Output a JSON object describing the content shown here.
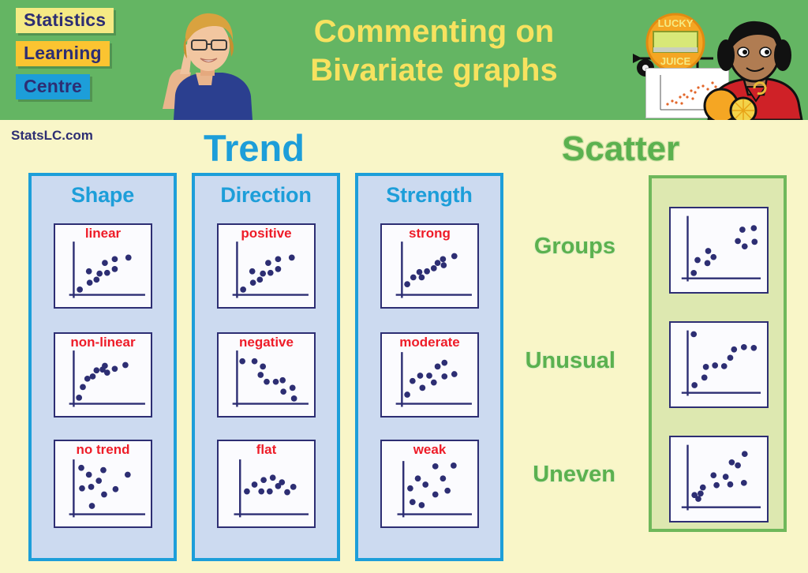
{
  "header": {
    "brand_lines": [
      "Statistics",
      "Learning",
      "Centre"
    ],
    "title_line1": "Commenting on",
    "title_line2": "Bivariate graphs",
    "cart_text_top": "LUCKY",
    "cart_text_bottom": "JUICE"
  },
  "site": {
    "url": "StatsLC.com"
  },
  "sections": {
    "trend": {
      "title": "Trend"
    },
    "scatter": {
      "title": "Scatter"
    }
  },
  "trend_panels": [
    {
      "heading": "Shape",
      "graphs": [
        "linear",
        "non-linear",
        "no trend"
      ]
    },
    {
      "heading": "Direction",
      "graphs": [
        "positive",
        "negative",
        "flat"
      ]
    },
    {
      "heading": "Strength",
      "graphs": [
        "strong",
        "moderate",
        "weak"
      ]
    }
  ],
  "scatter_rows": [
    {
      "label": "Groups"
    },
    {
      "label": "Unusual"
    },
    {
      "label": "Uneven"
    }
  ],
  "colors": {
    "header_green": "#64b563",
    "page_cream": "#f9f6c8",
    "panel_blue_fill": "#ccdaf0",
    "panel_blue_border": "#1d9ed9",
    "panel_green_fill": "#dde8b0",
    "panel_green_border": "#6fb85b",
    "label_red": "#ee1c28",
    "navy": "#2d2e73",
    "title_yellow": "#f7e25f",
    "scatter_green": "#5bb14f"
  },
  "chart_data": [
    {
      "type": "scatter",
      "title": "linear",
      "group": "Shape",
      "xlim": [
        0,
        100
      ],
      "ylim": [
        0,
        100
      ],
      "grid": false,
      "points": [
        [
          10,
          9
        ],
        [
          22,
          22
        ],
        [
          30,
          26
        ],
        [
          33,
          52
        ],
        [
          46,
          48
        ],
        [
          55,
          53
        ],
        [
          61,
          70
        ],
        [
          70,
          60
        ],
        [
          73,
          79
        ],
        [
          90,
          80
        ]
      ]
    },
    {
      "type": "scatter",
      "title": "non-linear",
      "group": "Shape",
      "xlim": [
        0,
        100
      ],
      "ylim": [
        0,
        100
      ],
      "grid": false,
      "points": [
        [
          9,
          10
        ],
        [
          16,
          30
        ],
        [
          23,
          46
        ],
        [
          31,
          51
        ],
        [
          38,
          62
        ],
        [
          46,
          64
        ],
        [
          53,
          70
        ],
        [
          58,
          58
        ],
        [
          67,
          64
        ],
        [
          85,
          72
        ]
      ]
    },
    {
      "type": "scatter",
      "title": "no trend",
      "group": "Shape",
      "xlim": [
        0,
        100
      ],
      "ylim": [
        0,
        100
      ],
      "grid": false,
      "points": [
        [
          12,
          77
        ],
        [
          24,
          64
        ],
        [
          14,
          40
        ],
        [
          29,
          40
        ],
        [
          36,
          50
        ],
        [
          44,
          78
        ],
        [
          48,
          28
        ],
        [
          62,
          36
        ],
        [
          80,
          60
        ],
        [
          33,
          8
        ]
      ]
    },
    {
      "type": "scatter",
      "title": "positive",
      "group": "Direction",
      "xlim": [
        0,
        100
      ],
      "ylim": [
        0,
        100
      ],
      "grid": false,
      "points": [
        [
          10,
          9
        ],
        [
          22,
          22
        ],
        [
          30,
          26
        ],
        [
          33,
          52
        ],
        [
          46,
          48
        ],
        [
          55,
          53
        ],
        [
          61,
          70
        ],
        [
          70,
          60
        ],
        [
          73,
          79
        ],
        [
          90,
          80
        ]
      ]
    },
    {
      "type": "scatter",
      "title": "negative",
      "group": "Direction",
      "xlim": [
        0,
        100
      ],
      "ylim": [
        0,
        100
      ],
      "grid": false,
      "points": [
        [
          9,
          80
        ],
        [
          24,
          80
        ],
        [
          35,
          71
        ],
        [
          32,
          56
        ],
        [
          43,
          46
        ],
        [
          54,
          46
        ],
        [
          63,
          48
        ],
        [
          67,
          24
        ],
        [
          80,
          30
        ],
        [
          83,
          12
        ]
      ]
    },
    {
      "type": "scatter",
      "title": "flat",
      "group": "Direction",
      "xlim": [
        0,
        100
      ],
      "ylim": [
        0,
        100
      ],
      "grid": false,
      "points": [
        [
          13,
          34
        ],
        [
          22,
          47
        ],
        [
          28,
          35
        ],
        [
          37,
          55
        ],
        [
          44,
          35
        ],
        [
          52,
          62
        ],
        [
          57,
          45
        ],
        [
          66,
          55
        ],
        [
          70,
          34
        ],
        [
          81,
          45
        ]
      ]
    },
    {
      "type": "scatter",
      "title": "strong",
      "group": "Strength",
      "xlim": [
        0,
        100
      ],
      "ylim": [
        0,
        100
      ],
      "grid": false,
      "points": [
        [
          9,
          20
        ],
        [
          17,
          33
        ],
        [
          25,
          42
        ],
        [
          30,
          33
        ],
        [
          36,
          44
        ],
        [
          45,
          47
        ],
        [
          52,
          55
        ],
        [
          60,
          63
        ],
        [
          63,
          52
        ],
        [
          70,
          66
        ],
        [
          85,
          72
        ]
      ]
    },
    {
      "type": "scatter",
      "title": "moderate",
      "group": "Strength",
      "xlim": [
        0,
        100
      ],
      "ylim": [
        0,
        100
      ],
      "grid": false,
      "points": [
        [
          9,
          15
        ],
        [
          17,
          40
        ],
        [
          28,
          35
        ],
        [
          33,
          52
        ],
        [
          43,
          52
        ],
        [
          48,
          36
        ],
        [
          57,
          69
        ],
        [
          66,
          79
        ],
        [
          69,
          50
        ],
        [
          84,
          55
        ]
      ]
    },
    {
      "type": "scatter",
      "title": "weak",
      "group": "Strength",
      "xlim": [
        0,
        100
      ],
      "ylim": [
        0,
        100
      ],
      "grid": false,
      "points": [
        [
          12,
          42
        ],
        [
          17,
          20
        ],
        [
          25,
          55
        ],
        [
          30,
          17
        ],
        [
          36,
          38
        ],
        [
          48,
          76
        ],
        [
          55,
          33
        ],
        [
          63,
          62
        ],
        [
          72,
          45
        ],
        [
          80,
          80
        ]
      ]
    },
    {
      "type": "scatter",
      "title": "Groups",
      "group": "Scatter",
      "xlim": [
        0,
        100
      ],
      "ylim": [
        0,
        100
      ],
      "grid": false,
      "points": [
        [
          9,
          13
        ],
        [
          13,
          32
        ],
        [
          22,
          26
        ],
        [
          23,
          45
        ],
        [
          27,
          37
        ],
        [
          56,
          56
        ],
        [
          63,
          75
        ],
        [
          66,
          48
        ],
        [
          78,
          78
        ],
        [
          80,
          57
        ]
      ]
    },
    {
      "type": "scatter",
      "title": "Unusual",
      "group": "Scatter",
      "xlim": [
        0,
        100
      ],
      "ylim": [
        0,
        100
      ],
      "grid": false,
      "points": [
        [
          10,
          92
        ],
        [
          12,
          14
        ],
        [
          23,
          27
        ],
        [
          25,
          42
        ],
        [
          34,
          45
        ],
        [
          44,
          43
        ],
        [
          50,
          58
        ],
        [
          55,
          70
        ],
        [
          67,
          73
        ],
        [
          80,
          72
        ]
      ]
    },
    {
      "type": "scatter",
      "title": "Uneven",
      "group": "Scatter",
      "xlim": [
        0,
        100
      ],
      "ylim": [
        0,
        100
      ],
      "grid": false,
      "points": [
        [
          12,
          24
        ],
        [
          16,
          18
        ],
        [
          19,
          27
        ],
        [
          21,
          38
        ],
        [
          34,
          55
        ],
        [
          38,
          36
        ],
        [
          50,
          53
        ],
        [
          55,
          38
        ],
        [
          57,
          73
        ],
        [
          63,
          68
        ],
        [
          70,
          42
        ],
        [
          72,
          86
        ]
      ]
    }
  ]
}
